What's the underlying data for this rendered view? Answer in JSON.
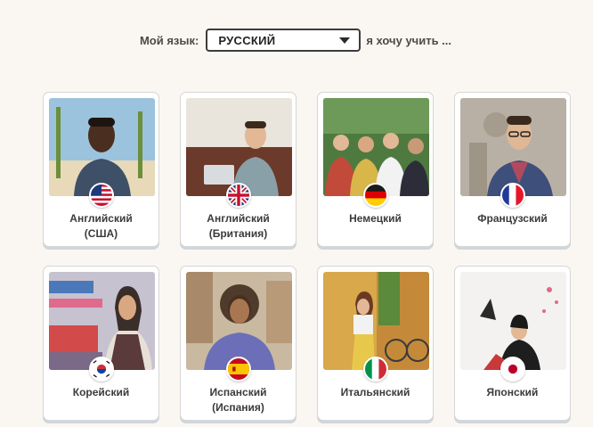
{
  "language_bar": {
    "my_language_label": "Мой язык:",
    "selected_language": "РУССКИЙ",
    "want_to_learn_label": "я хочу учить ..."
  },
  "courses": [
    {
      "line1": "Английский",
      "line2": "(США)",
      "flag": "us-flag-icon"
    },
    {
      "line1": "Английский",
      "line2": "(Британия)",
      "flag": "uk-flag-icon"
    },
    {
      "line1": "Немецкий",
      "line2": "",
      "flag": "germany-flag-icon"
    },
    {
      "line1": "Французский",
      "line2": "",
      "flag": "france-flag-icon"
    },
    {
      "line1": "Корейский",
      "line2": "",
      "flag": "korea-flag-icon"
    },
    {
      "line1": "Испанский",
      "line2": "(Испания)",
      "flag": "spain-flag-icon"
    },
    {
      "line1": "Итальянский",
      "line2": "",
      "flag": "italy-flag-icon"
    },
    {
      "line1": "Японский",
      "line2": "",
      "flag": "japan-flag-icon"
    }
  ],
  "colors": {
    "page_background": "#faf7f2",
    "card_border": "#d6d6d6",
    "select_border": "#3c3c3c"
  }
}
